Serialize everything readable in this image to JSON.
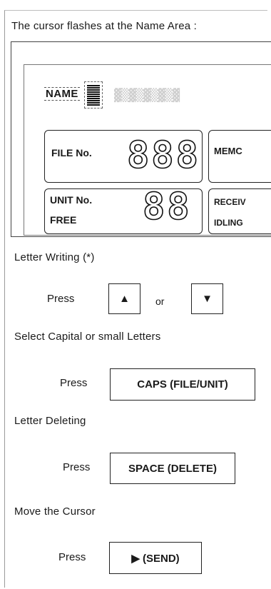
{
  "intro_text": "The cursor flashes at the Name Area :",
  "display": {
    "name_label": "NAME",
    "file_label": "FILE No.",
    "file_digits": "888",
    "memo_label": "MEMC",
    "unit_label": "UNIT No.",
    "free_label": "FREE",
    "unit_digits": "88",
    "receive_label": "RECEIV",
    "idling_label": "IDLING"
  },
  "steps": [
    {
      "title": "Letter Writing (*)",
      "press": "Press",
      "key1": "▲",
      "or": "or",
      "key2": "▼"
    },
    {
      "title": "Select Capital or small Letters",
      "press": "Press",
      "key": "CAPS (FILE/UNIT)"
    },
    {
      "title": "Letter Deleting",
      "press": "Press",
      "key": "SPACE (DELETE)"
    },
    {
      "title": "Move the Cursor",
      "press": "Press",
      "key": "▶ (SEND)"
    }
  ]
}
